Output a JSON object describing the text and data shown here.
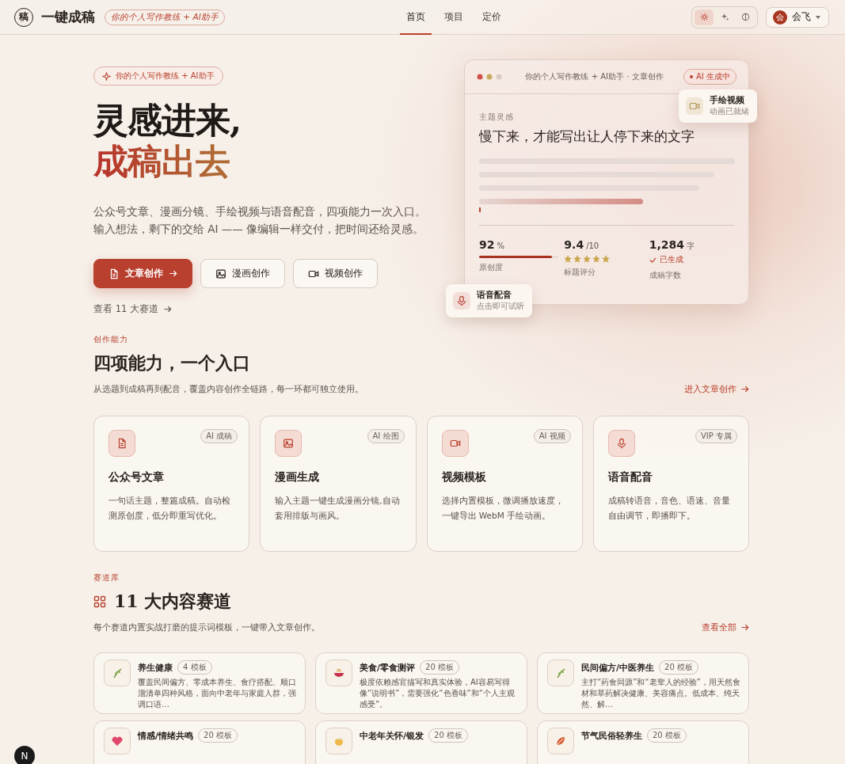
{
  "header": {
    "logo_char": "稿",
    "brand": "一键成稿",
    "tagline": "你的个人写作教练 + AI助手",
    "nav": [
      {
        "label": "首页",
        "selected": true
      },
      {
        "label": "项目",
        "selected": false
      },
      {
        "label": "定价",
        "selected": false
      }
    ],
    "theme_modes": [
      {
        "selected": true
      },
      {
        "selected": false
      },
      {
        "selected": false
      }
    ],
    "user": {
      "avatar_char": "会",
      "name": "会飞"
    }
  },
  "hero": {
    "badge": "你的个人写作教练 + AI助手",
    "title_line1": "灵感进来,",
    "title_line2": "成稿出去",
    "description_lines": [
      "公众号文章、漫画分镜、手绘视频与语音配音，四项能力一次入口。",
      "输入想法，剩下的交给 AI —— 像编辑一样交付，把时间还给灵感。"
    ],
    "buttons": [
      {
        "label": "文章创作",
        "primary": true
      },
      {
        "label": "漫画创作",
        "primary": false
      },
      {
        "label": "视频创作",
        "primary": false
      }
    ],
    "link": "查看 11 大赛道"
  },
  "preview": {
    "window_title": "你的个人写作教练 + AI助手 · 文章创作",
    "status": "AI 生成中",
    "eyebrow": "主题灵感",
    "headline": "慢下来，才能写出让人停下来的文字",
    "stats": [
      {
        "kind": "meter",
        "value": "92",
        "unit": "%",
        "label": "原创度",
        "level": 0.92
      },
      {
        "kind": "stars",
        "value": "9.4",
        "unit": "/10",
        "label": "标题评分",
        "stars": 5
      },
      {
        "kind": "status",
        "value": "1,284",
        "unit": "字",
        "status": "已生成",
        "label": "成稿字数"
      }
    ],
    "floating_cards": [
      {
        "title": "手绘视频",
        "subtitle": "动画已就绪"
      },
      {
        "title": "语音配音",
        "subtitle": "点击即可试听"
      }
    ]
  },
  "features": {
    "eyebrow": "创作能力",
    "title": "四项能力，一个入口",
    "subtitle": "从选题到成稿再到配音，覆盖内容创作全链路，每一环都可独立使用。",
    "link": "进入文章创作",
    "cards": [
      {
        "badge": "AI 成稿",
        "title": "公众号文章",
        "description": "一句话主题，整篇成稿。自动检测原创度，低分即重写优化。"
      },
      {
        "badge": "AI 绘图",
        "title": "漫画生成",
        "description": "输入主题一键生成漫画分镜,自动套用排版与画风。"
      },
      {
        "badge": "AI 视频",
        "title": "视频模板",
        "description": "选择内置模板，微调播放速度，一键导出 WebM 手绘动画。"
      },
      {
        "badge": "VIP 专属",
        "title": "语音配音",
        "description": "成稿转语音，音色、语速、音量自由调节，即播即下。"
      }
    ]
  },
  "tracks": {
    "eyebrow": "赛道库",
    "title": "11 大内容赛道",
    "subtitle": "每个赛道内置实战打磨的提示词模板，一键带入文章创作。",
    "link": "查看全部",
    "cards": [
      {
        "title": "养生健康",
        "count": "4 模板",
        "description": "覆盖民间偏方、零成本养生、食疗搭配、顺口溜清单四种风格，面向中老年与家庭人群，强调口语…"
      },
      {
        "title": "美食/零食测评",
        "count": "20 模板",
        "description": "极度依赖感官描写和真实体验，AI容易写得像“说明书”，需要强化“色香味”和“个人主观感受”。"
      },
      {
        "title": "民间偏方/中医养生",
        "count": "20 模板",
        "description": "主打“药食同源”和“老辈人的经验”，用天然食材和草药解决健康、美容痛点。低成本、纯天然、解…"
      },
      {
        "title": "情感/情绪共鸣",
        "count": "20 模板"
      },
      {
        "title": "中老年关怀/银发",
        "count": "20 模板"
      },
      {
        "title": "节气民俗轻养生",
        "count": "20 模板"
      }
    ]
  },
  "dev_indicator": "N"
}
